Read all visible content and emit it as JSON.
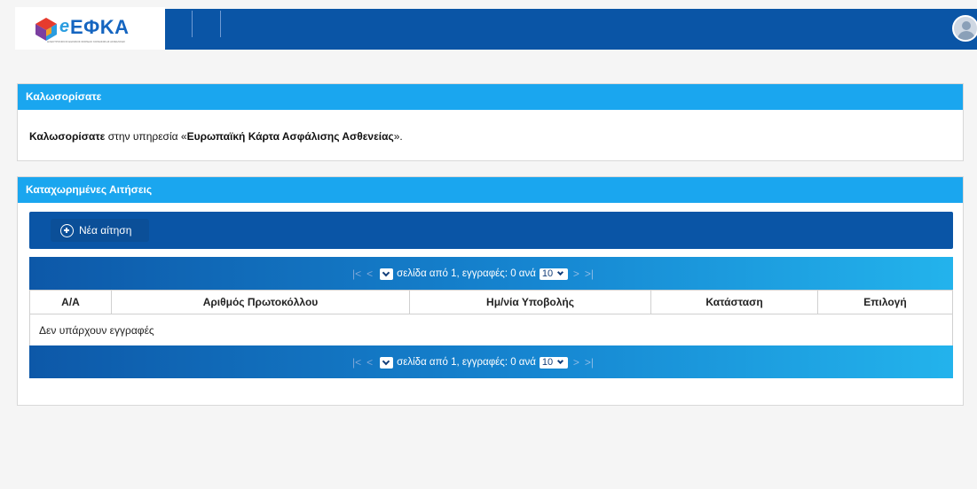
{
  "header": {
    "logo_e": "e",
    "logo_text": "ΕΦΚΑ",
    "logo_subtitle": "ΗΛΕΚΤΡΟΝΙΚΟΣ ΕΘΝΙΚΟΣ ΦΟΡΕΑΣ ΚΟΙΝΩΝΙΚΗΣ ΑΣΦΑΛΙΣΗΣ",
    "bar_color": "#0a55a6"
  },
  "welcome": {
    "title": "Καλωσορίσατε",
    "text_bold1": "Καλωσορίσατε",
    "text_plain": " στην υπηρεσία «",
    "text_bold2": "Ευρωπαϊκή Κάρτα Ασφάλισης Ασθενείας",
    "text_end": "»."
  },
  "applications": {
    "title": "Καταχωρημένες Αιτήσεις",
    "new_button": "Νέα αίτηση",
    "pager": {
      "first": "|<",
      "prev": "<",
      "next": ">",
      "last": ">|",
      "text": "σελίδα από 1, εγγραφές: 0 ανά",
      "page_size": "10"
    },
    "columns": [
      "Α/Α",
      "Αριθμός Πρωτοκόλλου",
      "Ημ/νία Υποβολής",
      "Κατάσταση",
      "Επιλογή"
    ],
    "empty_text": "Δεν υπάρχουν εγγραφές"
  },
  "colors": {
    "panel_header": "#1aa6ef",
    "toolbar": "#0a55a6"
  }
}
